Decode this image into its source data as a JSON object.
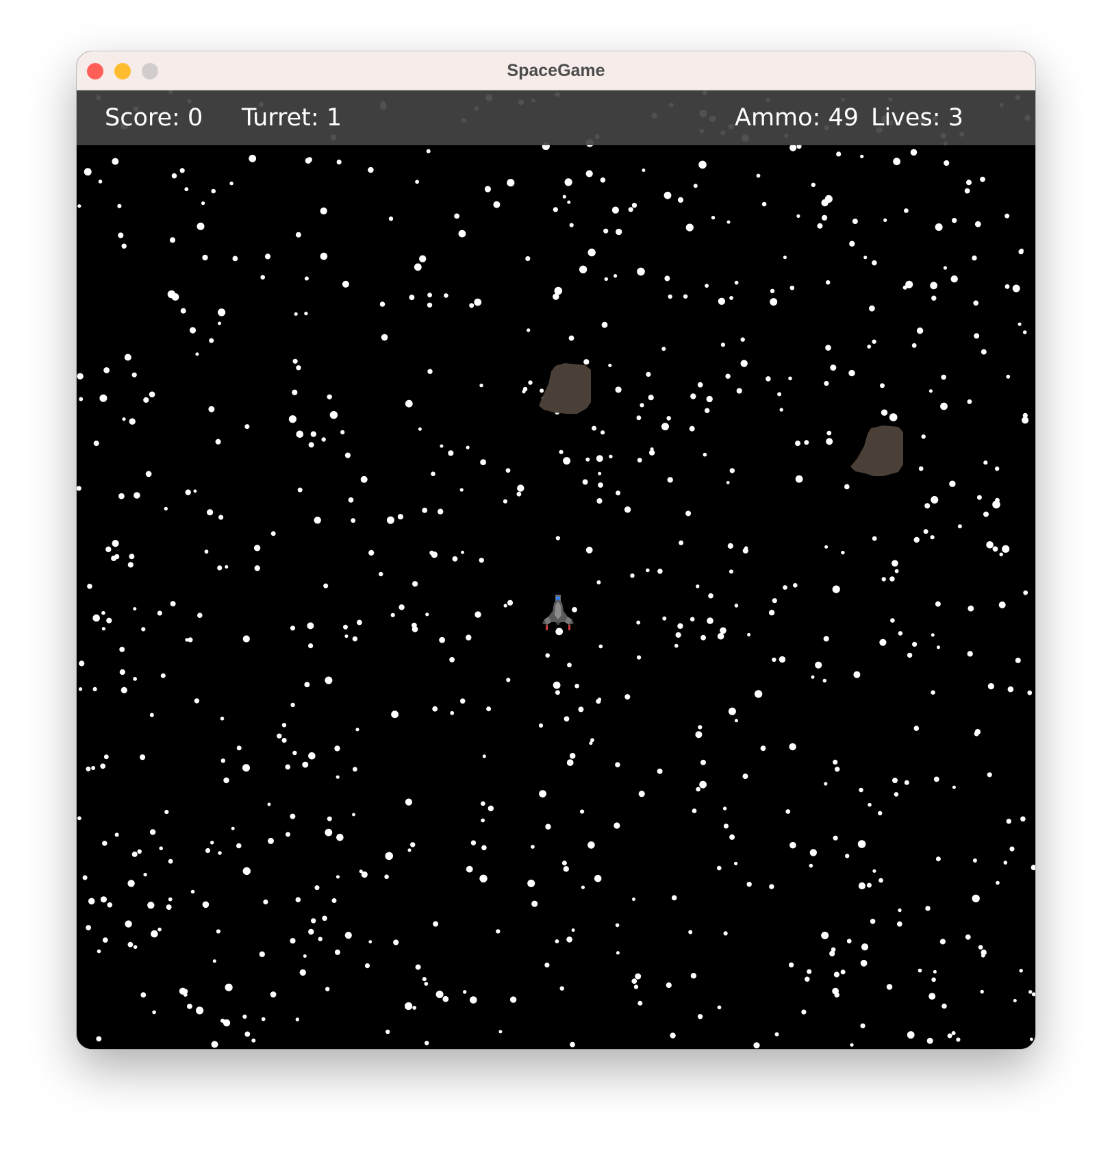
{
  "window": {
    "title": "SpaceGame",
    "buttons": {
      "close": "#ff5f57",
      "minimize": "#febc2e",
      "zoom": "#d0cdcc"
    }
  },
  "hud": {
    "score_label": "Score: 0",
    "turret_label": "Turret: 1",
    "ammo_label": "Ammo: 49",
    "lives_label": "Lives: 3"
  },
  "game": {
    "score": 0,
    "turret": 1,
    "ammo": 49,
    "lives": 3,
    "background_color": "#000000",
    "star_color": "#ffffff",
    "asteroid_color": "#4a4037",
    "hud_color": "#444444",
    "entities": [
      {
        "type": "asteroid",
        "icon": "asteroid-icon"
      },
      {
        "type": "asteroid",
        "icon": "asteroid-icon"
      },
      {
        "type": "player-ship",
        "icon": "spaceship-icon"
      }
    ]
  }
}
